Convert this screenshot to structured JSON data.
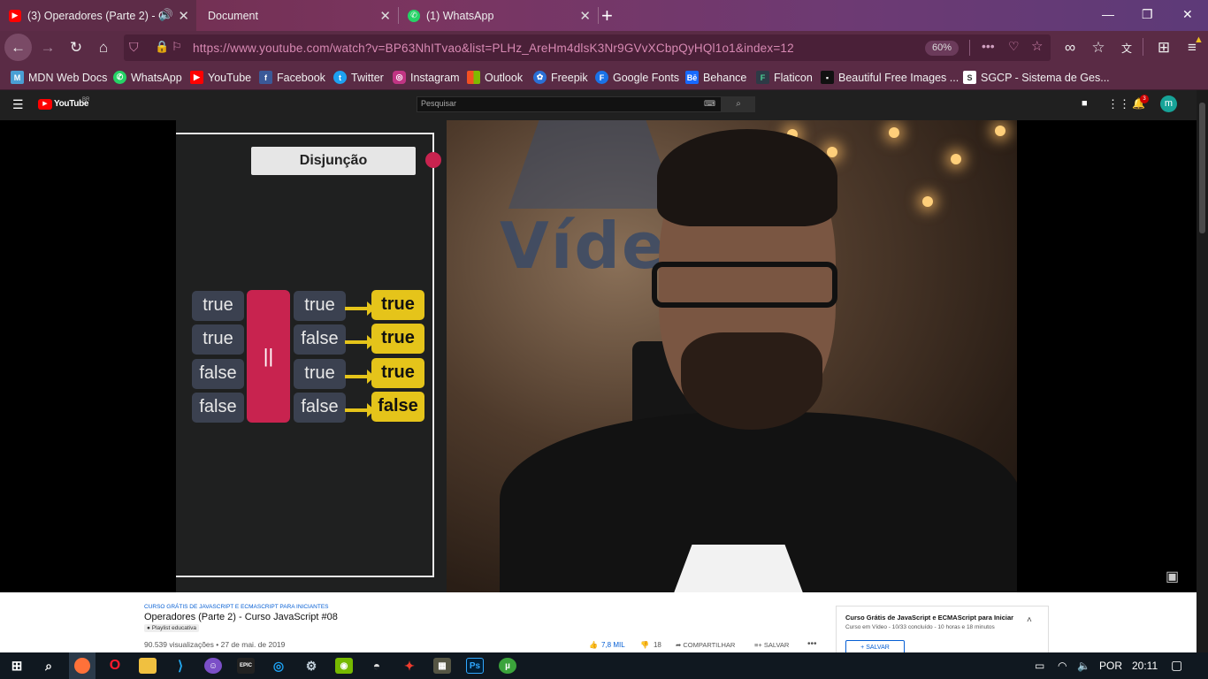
{
  "browser": {
    "tabs": [
      {
        "label": "(3) Operadores (Parte 2) - C",
        "active": true
      },
      {
        "label": "Document",
        "active": false
      },
      {
        "label": "(1) WhatsApp",
        "active": false
      }
    ],
    "url": "https://www.youtube.com/watch?v=BP63NhITvao&list=PLHz_AreHm4dlsK3Nr9GVvXCbpQyHQl1o1&index=12",
    "zoom": "60%",
    "bookmarks": [
      {
        "label": "MDN Web Docs",
        "icon": "mdn-icon",
        "color": "#4a9fd4"
      },
      {
        "label": "WhatsApp",
        "icon": "whatsapp-icon",
        "color": "#25d366"
      },
      {
        "label": "YouTube",
        "icon": "youtube-icon",
        "color": "#ff0000"
      },
      {
        "label": "Facebook",
        "icon": "facebook-icon",
        "color": "#3b5998"
      },
      {
        "label": "Twitter",
        "icon": "twitter-icon",
        "color": "#1da1f2"
      },
      {
        "label": "Instagram",
        "icon": "instagram-icon",
        "color": "#c13584"
      },
      {
        "label": "Outlook",
        "icon": "outlook-icon",
        "color": "#f25022"
      },
      {
        "label": "Freepik",
        "icon": "freepik-icon",
        "color": "#2a70d6"
      },
      {
        "label": "Google Fonts",
        "icon": "google-fonts-icon",
        "color": "#1a73e8"
      },
      {
        "label": "Behance",
        "icon": "behance-icon",
        "color": "#1769ff"
      },
      {
        "label": "Flaticon",
        "icon": "flaticon-icon",
        "color": "#4ad295"
      },
      {
        "label": "Beautiful Free Images ...",
        "icon": "unsplash-icon",
        "color": "#111111"
      },
      {
        "label": "SGCP - Sistema de Ges...",
        "icon": "sgcp-icon",
        "color": "#ffffff"
      }
    ]
  },
  "youtube": {
    "logo": "YouTube",
    "region": "BR",
    "search_placeholder": "Pesquisar",
    "notifications_count": "3",
    "avatar_letter": "m"
  },
  "video": {
    "slide_title": "Disjunção",
    "operator": "||",
    "rows": [
      {
        "a": "true",
        "b": "true",
        "result": "true"
      },
      {
        "a": "true",
        "b": "false",
        "result": "true"
      },
      {
        "a": "false",
        "b": "true",
        "result": "true"
      },
      {
        "a": "false",
        "b": "false",
        "result": "false"
      }
    ],
    "background_logo": "Vídeo"
  },
  "info": {
    "playlist_tag": "CURSO GRÁTIS DE JAVASCRIPT E ECMASCRIPT PARA INICIANTES",
    "title": "Operadores (Parte 2) - Curso JavaScript #08",
    "badge": "Playlist educativa",
    "meta": "90.539 visualizações • 27 de mai. de 2019",
    "likes": "7,8 MIL",
    "dislikes": "18",
    "share": "COMPARTILHAR",
    "save": "SALVAR",
    "playlist_title": "Curso Grátis de JavaScript e ECMAScript para Iniciar",
    "playlist_meta": "Curso em Vídeo - 10/33 concluído - 10 horas e 18 minutos",
    "playlist_save": "SALVAR"
  },
  "taskbar": {
    "lang": "POR",
    "time": "20:11"
  }
}
